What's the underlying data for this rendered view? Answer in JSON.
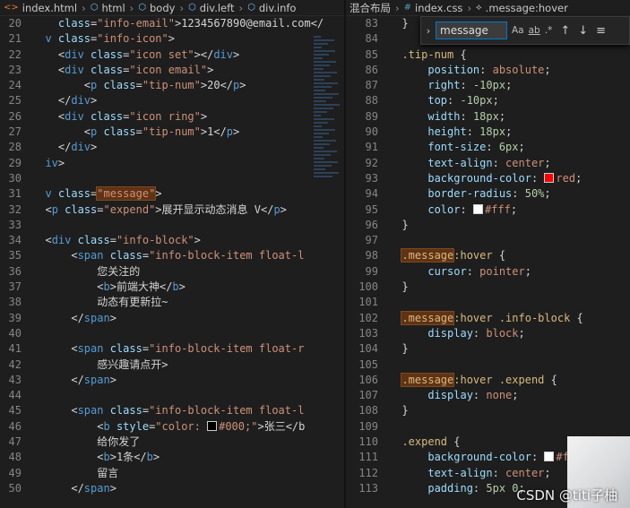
{
  "left_breadcrumb": [
    "index.html",
    "html",
    "body",
    "div.left",
    "div.info"
  ],
  "right_breadcrumb": [
    "混合布局",
    "index.css",
    ".message:hover"
  ],
  "find": {
    "value": "message",
    "match_case": "Aa",
    "whole_word": "ab",
    "regex": ".*"
  },
  "watermark": "CSDN @titi子柚",
  "left_lines": [
    {
      "n": "20",
      "code": [
        [
          "attr",
          "    class"
        ],
        [
          "punc",
          "="
        ],
        [
          "str",
          "\"info-email\""
        ],
        [
          "punc",
          ">"
        ],
        [
          "txt",
          "1234567890@email.com</"
        ]
      ]
    },
    {
      "n": "21",
      "code": [
        [
          "tag",
          "  v "
        ],
        [
          "attr",
          "class"
        ],
        [
          "punc",
          "="
        ],
        [
          "str",
          "\"info-icon\""
        ],
        [
          "punc",
          ">"
        ]
      ]
    },
    {
      "n": "22",
      "code": [
        [
          "punc",
          "    <"
        ],
        [
          "tag",
          "div "
        ],
        [
          "attr",
          "class"
        ],
        [
          "punc",
          "="
        ],
        [
          "str",
          "\"icon set\""
        ],
        [
          "punc",
          "></"
        ],
        [
          "tag",
          "div"
        ],
        [
          "punc",
          ">"
        ]
      ]
    },
    {
      "n": "23",
      "code": [
        [
          "punc",
          "    <"
        ],
        [
          "tag",
          "div "
        ],
        [
          "attr",
          "class"
        ],
        [
          "punc",
          "="
        ],
        [
          "str",
          "\"icon email\""
        ],
        [
          "punc",
          ">"
        ]
      ]
    },
    {
      "n": "24",
      "code": [
        [
          "punc",
          "        <"
        ],
        [
          "tag",
          "p "
        ],
        [
          "attr",
          "class"
        ],
        [
          "punc",
          "="
        ],
        [
          "str",
          "\"tip-num\""
        ],
        [
          "punc",
          ">"
        ],
        [
          "txt",
          "20"
        ],
        [
          "punc",
          "</"
        ],
        [
          "tag",
          "p"
        ],
        [
          "punc",
          ">"
        ]
      ]
    },
    {
      "n": "25",
      "code": [
        [
          "punc",
          "    </"
        ],
        [
          "tag",
          "div"
        ],
        [
          "punc",
          ">"
        ]
      ]
    },
    {
      "n": "26",
      "code": [
        [
          "punc",
          "    <"
        ],
        [
          "tag",
          "div "
        ],
        [
          "attr",
          "class"
        ],
        [
          "punc",
          "="
        ],
        [
          "str",
          "\"icon ring\""
        ],
        [
          "punc",
          ">"
        ]
      ]
    },
    {
      "n": "27",
      "code": [
        [
          "punc",
          "        <"
        ],
        [
          "tag",
          "p "
        ],
        [
          "attr",
          "class"
        ],
        [
          "punc",
          "="
        ],
        [
          "str",
          "\"tip-num\""
        ],
        [
          "punc",
          ">"
        ],
        [
          "txt",
          "1"
        ],
        [
          "punc",
          "</"
        ],
        [
          "tag",
          "p"
        ],
        [
          "punc",
          ">"
        ]
      ]
    },
    {
      "n": "28",
      "code": [
        [
          "punc",
          "    </"
        ],
        [
          "tag",
          "div"
        ],
        [
          "punc",
          ">"
        ]
      ]
    },
    {
      "n": "29",
      "code": [
        [
          "tag",
          "  iv"
        ],
        [
          "punc",
          ">"
        ]
      ]
    },
    {
      "n": "30",
      "code": []
    },
    {
      "n": "31",
      "code": [
        [
          "tag",
          "  v "
        ],
        [
          "attr",
          "class"
        ],
        [
          "punc",
          "="
        ],
        [
          "str",
          "\"message\""
        ],
        [
          "punc",
          ">"
        ]
      ],
      "hl": "\"message\""
    },
    {
      "n": "32",
      "code": [
        [
          "punc",
          "  <"
        ],
        [
          "tag",
          "p "
        ],
        [
          "attr",
          "class"
        ],
        [
          "punc",
          "="
        ],
        [
          "str",
          "\"expend\""
        ],
        [
          "punc",
          ">"
        ],
        [
          "txt",
          "展开显示动态消息 V"
        ],
        [
          "punc",
          "</"
        ],
        [
          "tag",
          "p"
        ],
        [
          "punc",
          ">"
        ]
      ]
    },
    {
      "n": "33",
      "code": []
    },
    {
      "n": "34",
      "code": [
        [
          "punc",
          "  <"
        ],
        [
          "tag",
          "div "
        ],
        [
          "attr",
          "class"
        ],
        [
          "punc",
          "="
        ],
        [
          "str",
          "\"info-block\""
        ],
        [
          "punc",
          ">"
        ]
      ]
    },
    {
      "n": "35",
      "code": [
        [
          "punc",
          "      <"
        ],
        [
          "tag",
          "span "
        ],
        [
          "attr",
          "class"
        ],
        [
          "punc",
          "="
        ],
        [
          "str",
          "\"info-block-item float-l"
        ]
      ]
    },
    {
      "n": "36",
      "code": [
        [
          "txt",
          "          您关注的"
        ]
      ]
    },
    {
      "n": "37",
      "code": [
        [
          "punc",
          "          <"
        ],
        [
          "tag",
          "b"
        ],
        [
          "punc",
          ">"
        ],
        [
          "txt",
          "前端大神"
        ],
        [
          "punc",
          "</"
        ],
        [
          "tag",
          "b"
        ],
        [
          "punc",
          ">"
        ]
      ]
    },
    {
      "n": "38",
      "code": [
        [
          "txt",
          "          动态有更新拉~"
        ]
      ]
    },
    {
      "n": "39",
      "code": [
        [
          "punc",
          "      </"
        ],
        [
          "tag",
          "span"
        ],
        [
          "punc",
          ">"
        ]
      ]
    },
    {
      "n": "40",
      "code": []
    },
    {
      "n": "41",
      "code": [
        [
          "punc",
          "      <"
        ],
        [
          "tag",
          "span "
        ],
        [
          "attr",
          "class"
        ],
        [
          "punc",
          "="
        ],
        [
          "str",
          "\"info-block-item float-r"
        ]
      ]
    },
    {
      "n": "42",
      "code": [
        [
          "txt",
          "          感兴趣请点开>"
        ]
      ]
    },
    {
      "n": "43",
      "code": [
        [
          "punc",
          "      </"
        ],
        [
          "tag",
          "span"
        ],
        [
          "punc",
          ">"
        ]
      ]
    },
    {
      "n": "44",
      "code": []
    },
    {
      "n": "45",
      "code": [
        [
          "punc",
          "      <"
        ],
        [
          "tag",
          "span "
        ],
        [
          "attr",
          "class"
        ],
        [
          "punc",
          "="
        ],
        [
          "str",
          "\"info-block-item float-l"
        ]
      ]
    },
    {
      "n": "46",
      "code": [
        [
          "punc",
          "          <"
        ],
        [
          "tag",
          "b "
        ],
        [
          "attr",
          "style"
        ],
        [
          "punc",
          "="
        ],
        [
          "str",
          "\"color: "
        ],
        [
          "swatch",
          "#000000"
        ],
        [
          "str",
          "#000;\""
        ],
        [
          "punc",
          ">"
        ],
        [
          "txt",
          "张三</b"
        ]
      ]
    },
    {
      "n": "47",
      "code": [
        [
          "txt",
          "          给你发了"
        ]
      ]
    },
    {
      "n": "48",
      "code": [
        [
          "punc",
          "          <"
        ],
        [
          "tag",
          "b"
        ],
        [
          "punc",
          ">"
        ],
        [
          "txt",
          "1条"
        ],
        [
          "punc",
          "</"
        ],
        [
          "tag",
          "b"
        ],
        [
          "punc",
          ">"
        ]
      ]
    },
    {
      "n": "49",
      "code": [
        [
          "txt",
          "          留言"
        ]
      ]
    },
    {
      "n": "50",
      "code": [
        [
          "punc",
          "      </"
        ],
        [
          "tag",
          "span"
        ],
        [
          "punc",
          ">"
        ]
      ]
    }
  ],
  "right_lines": [
    {
      "n": "83",
      "code": [
        [
          "punc",
          "  }"
        ]
      ]
    },
    {
      "n": "84",
      "code": []
    },
    {
      "n": "85",
      "code": [
        [
          "sel",
          "  .tip-num "
        ],
        [
          "punc",
          "{"
        ]
      ]
    },
    {
      "n": "86",
      "code": [
        [
          "prop",
          "      position"
        ],
        [
          "punc",
          ": "
        ],
        [
          "val",
          "absolute"
        ],
        [
          "punc",
          ";"
        ]
      ]
    },
    {
      "n": "87",
      "code": [
        [
          "prop",
          "      right"
        ],
        [
          "punc",
          ": "
        ],
        [
          "num",
          "-10px"
        ],
        [
          "punc",
          ";"
        ]
      ]
    },
    {
      "n": "88",
      "code": [
        [
          "prop",
          "      top"
        ],
        [
          "punc",
          ": "
        ],
        [
          "num",
          "-10px"
        ],
        [
          "punc",
          ";"
        ]
      ]
    },
    {
      "n": "89",
      "code": [
        [
          "prop",
          "      width"
        ],
        [
          "punc",
          ": "
        ],
        [
          "num",
          "18px"
        ],
        [
          "punc",
          ";"
        ]
      ]
    },
    {
      "n": "90",
      "code": [
        [
          "prop",
          "      height"
        ],
        [
          "punc",
          ": "
        ],
        [
          "num",
          "18px"
        ],
        [
          "punc",
          ";"
        ]
      ]
    },
    {
      "n": "91",
      "code": [
        [
          "prop",
          "      font-size"
        ],
        [
          "punc",
          ": "
        ],
        [
          "num",
          "6px"
        ],
        [
          "punc",
          ";"
        ]
      ]
    },
    {
      "n": "92",
      "code": [
        [
          "prop",
          "      text-align"
        ],
        [
          "punc",
          ": "
        ],
        [
          "val",
          "center"
        ],
        [
          "punc",
          ";"
        ]
      ]
    },
    {
      "n": "93",
      "code": [
        [
          "prop",
          "      background-color"
        ],
        [
          "punc",
          ": "
        ],
        [
          "swatch",
          "#ff0000"
        ],
        [
          "val",
          "red"
        ],
        [
          "punc",
          ";"
        ]
      ]
    },
    {
      "n": "94",
      "code": [
        [
          "prop",
          "      border-radius"
        ],
        [
          "punc",
          ": "
        ],
        [
          "num",
          "50%"
        ],
        [
          "punc",
          ";"
        ]
      ]
    },
    {
      "n": "95",
      "code": [
        [
          "prop",
          "      color"
        ],
        [
          "punc",
          ": "
        ],
        [
          "swatch",
          "#ffffff"
        ],
        [
          "val",
          "#fff"
        ],
        [
          "punc",
          ";"
        ]
      ]
    },
    {
      "n": "96",
      "code": [
        [
          "punc",
          "  }"
        ]
      ]
    },
    {
      "n": "97",
      "code": []
    },
    {
      "n": "98",
      "code": [
        [
          "sel",
          "  "
        ],
        [
          "selhl",
          ".message"
        ],
        [
          "sel",
          ":hover "
        ],
        [
          "punc",
          "{"
        ]
      ]
    },
    {
      "n": "99",
      "code": [
        [
          "prop",
          "      cursor"
        ],
        [
          "punc",
          ": "
        ],
        [
          "val",
          "pointer"
        ],
        [
          "punc",
          ";"
        ]
      ]
    },
    {
      "n": "100",
      "code": [
        [
          "punc",
          "  }"
        ]
      ]
    },
    {
      "n": "101",
      "code": []
    },
    {
      "n": "102",
      "code": [
        [
          "sel",
          "  "
        ],
        [
          "selhl",
          ".message"
        ],
        [
          "sel",
          ":hover .info-block "
        ],
        [
          "punc",
          "{"
        ]
      ]
    },
    {
      "n": "103",
      "code": [
        [
          "prop",
          "      display"
        ],
        [
          "punc",
          ": "
        ],
        [
          "val",
          "block"
        ],
        [
          "punc",
          ";"
        ]
      ]
    },
    {
      "n": "104",
      "code": [
        [
          "punc",
          "  }"
        ]
      ]
    },
    {
      "n": "105",
      "code": []
    },
    {
      "n": "106",
      "code": [
        [
          "sel",
          "  "
        ],
        [
          "selhl",
          ".message"
        ],
        [
          "sel",
          ":hover .expend "
        ],
        [
          "punc",
          "{"
        ]
      ]
    },
    {
      "n": "107",
      "code": [
        [
          "prop",
          "      display"
        ],
        [
          "punc",
          ": "
        ],
        [
          "val",
          "none"
        ],
        [
          "punc",
          ";"
        ]
      ]
    },
    {
      "n": "108",
      "code": [
        [
          "punc",
          "  }"
        ]
      ]
    },
    {
      "n": "109",
      "code": []
    },
    {
      "n": "110",
      "code": [
        [
          "sel",
          "  .expend "
        ],
        [
          "punc",
          "{"
        ]
      ]
    },
    {
      "n": "111",
      "code": [
        [
          "prop",
          "      background-color"
        ],
        [
          "punc",
          ": "
        ],
        [
          "swatch",
          "#ffffff"
        ],
        [
          "val",
          "#f"
        ]
      ]
    },
    {
      "n": "112",
      "code": [
        [
          "prop",
          "      text-align"
        ],
        [
          "punc",
          ": "
        ],
        [
          "val",
          "center"
        ],
        [
          "punc",
          ";"
        ]
      ]
    },
    {
      "n": "113",
      "code": [
        [
          "prop",
          "      padding"
        ],
        [
          "punc",
          ": "
        ],
        [
          "num",
          "5px 0"
        ],
        [
          "punc",
          ";"
        ]
      ]
    }
  ]
}
